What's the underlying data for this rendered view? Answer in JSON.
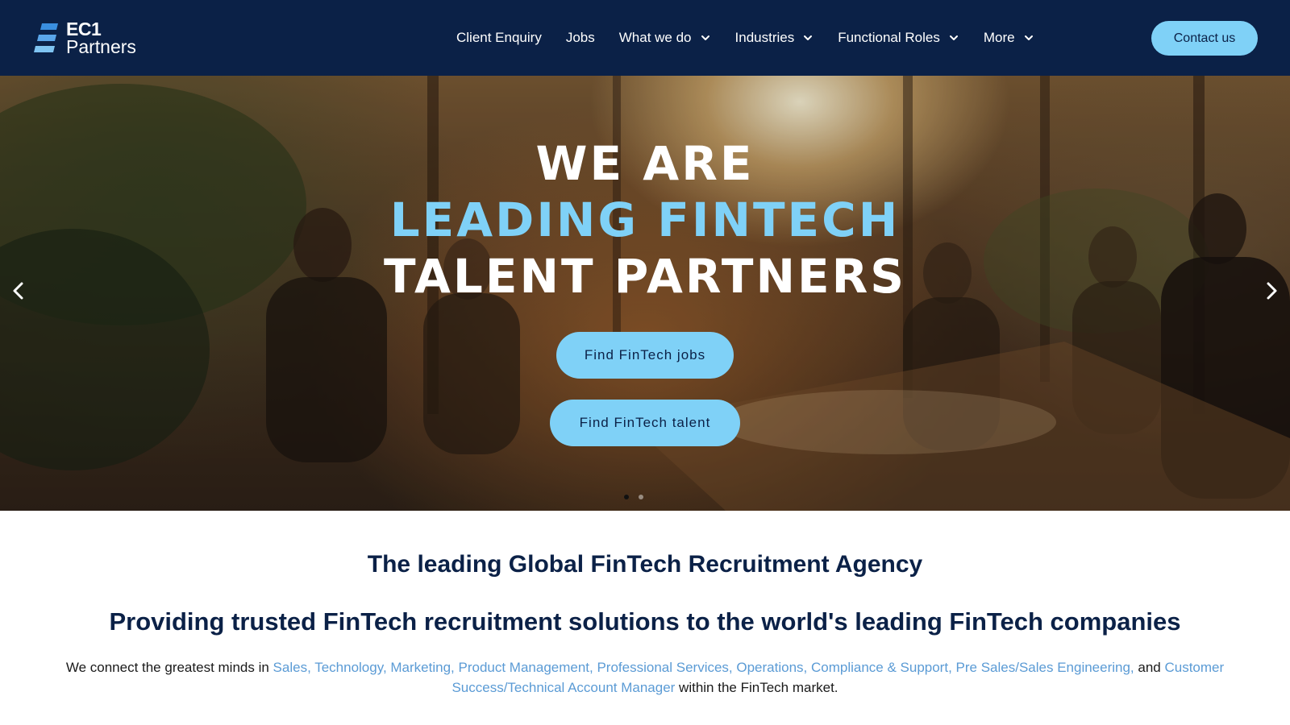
{
  "logo": {
    "line1": "EC1",
    "line2": "Partners"
  },
  "nav": {
    "items": [
      {
        "label": "Client Enquiry",
        "dropdown": false
      },
      {
        "label": "Jobs",
        "dropdown": false
      },
      {
        "label": "What we do",
        "dropdown": true
      },
      {
        "label": "Industries",
        "dropdown": true
      },
      {
        "label": "Functional Roles",
        "dropdown": true
      },
      {
        "label": "More",
        "dropdown": true
      }
    ],
    "contact_label": "Contact us"
  },
  "hero": {
    "line1": "WE ARE",
    "line2": "LEADING FINTECH",
    "line3": "TALENT PARTNERS",
    "jobs_button": "Find FinTech jobs",
    "talent_button": "Find FinTech talent",
    "slide_count": 2,
    "active_slide": 1
  },
  "content": {
    "heading": "The leading Global FinTech Recruitment Agency",
    "subheading": "Providing trusted FinTech recruitment solutions to the world's leading FinTech companies",
    "intro_prefix": "We connect the greatest minds in ",
    "intro_links": "Sales, Technology, Marketing, Product Management, Professional Services, Operations, Compliance & Support, Pre Sales/Sales Engineering,",
    "intro_and": " and ",
    "intro_link_last": "Customer Success/Technical Account Manager",
    "intro_suffix": " within the FinTech market."
  },
  "colors": {
    "header_bg": "#0b2147",
    "accent": "#7fd1f7",
    "link": "#5b9bd5",
    "heading": "#0b2147"
  },
  "icons": [
    "logo-mark-icon",
    "chevron-down-icon",
    "arrow-left-icon",
    "arrow-right-icon"
  ]
}
